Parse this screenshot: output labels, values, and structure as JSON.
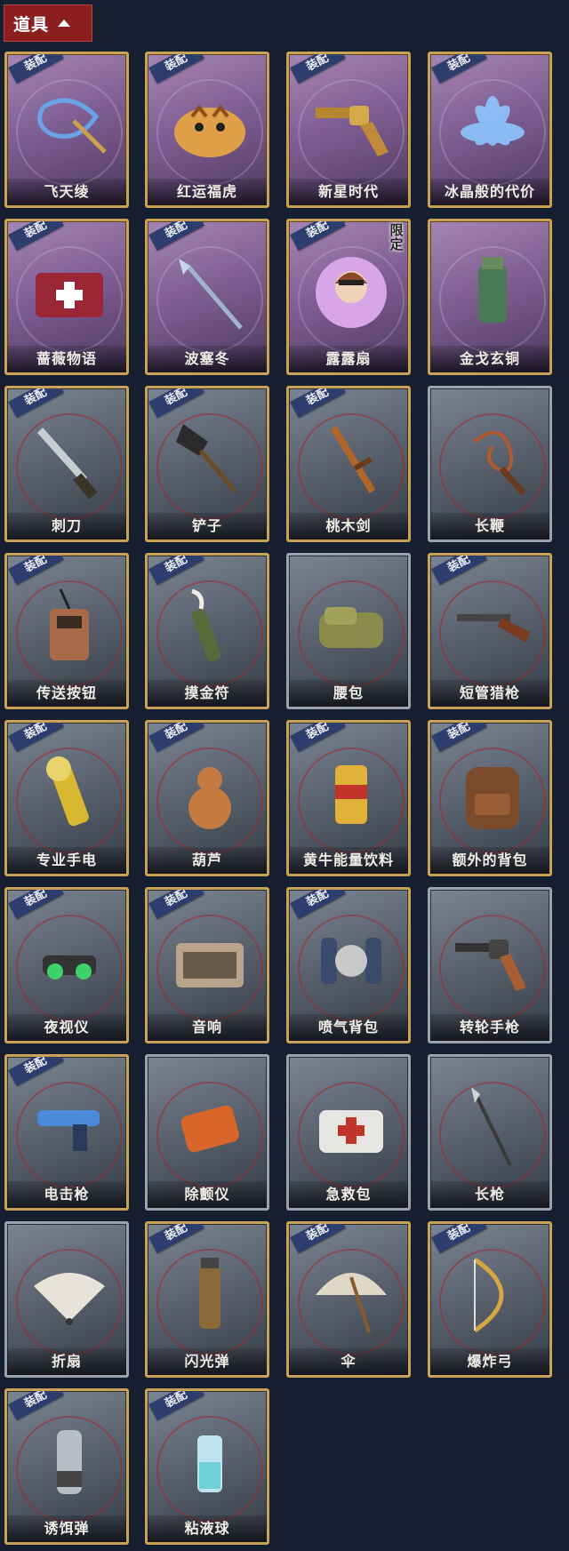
{
  "header": {
    "title": "道具"
  },
  "equip_tag": "装配",
  "limited_tag": "限定",
  "items": [
    {
      "label": "飞天绫",
      "theme": "purple",
      "equipped": true,
      "icon": "ribbon-staff-icon"
    },
    {
      "label": "红运福虎",
      "theme": "purple",
      "equipped": true,
      "icon": "tiger-plush-icon"
    },
    {
      "label": "新星时代",
      "theme": "purple",
      "equipped": true,
      "icon": "gold-revolver-icon"
    },
    {
      "label": "冰晶般的代价",
      "theme": "purple",
      "equipped": true,
      "icon": "ice-lotus-icon"
    },
    {
      "label": "蔷薇物语",
      "theme": "purple",
      "equipped": true,
      "icon": "rose-medkit-icon"
    },
    {
      "label": "波塞冬",
      "theme": "purple",
      "equipped": true,
      "icon": "trident-icon"
    },
    {
      "label": "露露扇",
      "theme": "purple",
      "equipped": true,
      "limited": true,
      "icon": "lulu-fan-icon"
    },
    {
      "label": "金戈玄铜",
      "theme": "purple",
      "equipped": false,
      "icon": "bronze-grenade-icon"
    },
    {
      "label": "刺刀",
      "theme": "grey",
      "equipped": true,
      "icon": "bayonet-icon"
    },
    {
      "label": "铲子",
      "theme": "grey",
      "equipped": true,
      "icon": "shovel-icon"
    },
    {
      "label": "桃木剑",
      "theme": "grey",
      "equipped": true,
      "icon": "wooden-sword-icon"
    },
    {
      "label": "长鞭",
      "theme": "grey",
      "equipped": false,
      "icon": "whip-icon"
    },
    {
      "label": "传送按钮",
      "theme": "grey",
      "equipped": true,
      "icon": "teleport-button-icon"
    },
    {
      "label": "摸金符",
      "theme": "grey",
      "equipped": true,
      "icon": "talisman-icon"
    },
    {
      "label": "腰包",
      "theme": "grey",
      "equipped": false,
      "icon": "waist-bag-icon"
    },
    {
      "label": "短管猎枪",
      "theme": "grey",
      "equipped": true,
      "icon": "shotgun-icon"
    },
    {
      "label": "专业手电",
      "theme": "grey",
      "equipped": true,
      "icon": "flashlight-icon"
    },
    {
      "label": "葫芦",
      "theme": "grey",
      "equipped": true,
      "icon": "gourd-icon"
    },
    {
      "label": "黄牛能量饮料",
      "theme": "grey",
      "equipped": true,
      "icon": "energy-drink-icon"
    },
    {
      "label": "额外的背包",
      "theme": "grey",
      "equipped": true,
      "icon": "backpack-icon"
    },
    {
      "label": "夜视仪",
      "theme": "grey",
      "equipped": true,
      "icon": "night-vision-icon"
    },
    {
      "label": "音响",
      "theme": "grey",
      "equipped": true,
      "icon": "boombox-icon"
    },
    {
      "label": "喷气背包",
      "theme": "grey",
      "equipped": true,
      "icon": "jetpack-icon"
    },
    {
      "label": "转轮手枪",
      "theme": "grey",
      "equipped": false,
      "icon": "revolver-icon"
    },
    {
      "label": "电击枪",
      "theme": "grey",
      "equipped": true,
      "icon": "shock-gun-icon"
    },
    {
      "label": "除颤仪",
      "theme": "grey",
      "equipped": false,
      "icon": "defibrillator-icon"
    },
    {
      "label": "急救包",
      "theme": "grey",
      "equipped": false,
      "icon": "first-aid-kit-icon"
    },
    {
      "label": "长枪",
      "theme": "grey",
      "equipped": false,
      "icon": "spear-icon"
    },
    {
      "label": "折扇",
      "theme": "grey",
      "equipped": false,
      "icon": "folding-fan-icon"
    },
    {
      "label": "闪光弹",
      "theme": "grey",
      "equipped": true,
      "icon": "flashbang-icon"
    },
    {
      "label": "伞",
      "theme": "grey",
      "equipped": true,
      "icon": "umbrella-icon"
    },
    {
      "label": "爆炸弓",
      "theme": "grey",
      "equipped": true,
      "icon": "bow-icon"
    },
    {
      "label": "诱饵弹",
      "theme": "grey",
      "equipped": true,
      "icon": "decoy-grenade-icon"
    },
    {
      "label": "粘液球",
      "theme": "grey",
      "equipped": true,
      "icon": "slime-ball-icon"
    }
  ]
}
